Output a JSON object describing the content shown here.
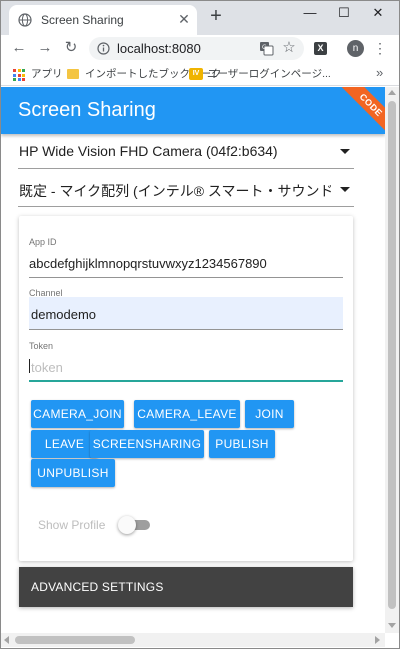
{
  "browser": {
    "tab_title": "Screen Sharing",
    "tab_close_glyph": "✕",
    "new_tab_glyph": "+",
    "window_controls": {
      "minimize": "—",
      "maximize": "☐",
      "close": "✕"
    },
    "nav": {
      "back": "←",
      "forward": "→",
      "reload": "↻"
    },
    "url": "localhost:8080",
    "star_glyph": "☆",
    "extension_label": "X",
    "profile_initial": "n",
    "menu_glyph": "⋮",
    "bookmarks": [
      {
        "label": "アプリ",
        "icon": "apps-grid-icon"
      },
      {
        "label": "インポートしたブックマーク",
        "icon": "folder-icon"
      },
      {
        "label": "ユーザーログインページ...",
        "icon": "iv-icon"
      }
    ],
    "iv_icon_text": "IV",
    "bookmarks_more": "»"
  },
  "app": {
    "title": "Screen Sharing",
    "ribbon": "CODE",
    "colors": {
      "primary": "#2196f3",
      "ribbon": "#f26522",
      "dark_panel": "#424242",
      "focus_line": "#26a69a"
    },
    "camera_select": "HP Wide Vision FHD Camera (04f2:b634)",
    "mic_select": "既定 - マイク配列 (インテル® スマート・サウンド・テクノロジー)",
    "form": {
      "app_id_label": "App ID",
      "app_id_value": "abcdefghijklmnopqrstuvwxyz1234567890",
      "channel_label": "Channel",
      "channel_value": "demodemo",
      "token_label": "Token",
      "token_placeholder": "token"
    },
    "buttons": {
      "camera_join": "CAMERA_JOIN",
      "camera_leave": "CAMERA_LEAVE",
      "join": "JOIN",
      "leave": "LEAVE",
      "screensharing": "SCREENSHARING",
      "publish": "PUBLISH",
      "unpublish": "UNPUBLISH"
    },
    "show_profile_label": "Show Profile",
    "show_profile_on": false,
    "advanced_settings": "ADVANCED SETTINGS"
  }
}
